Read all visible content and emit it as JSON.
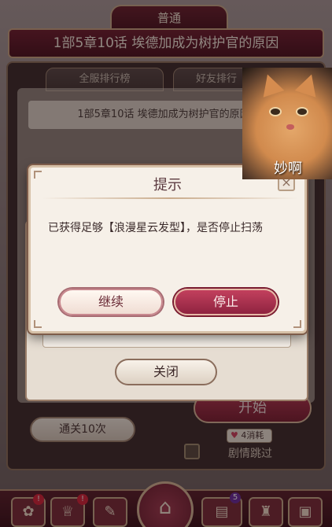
{
  "header": {
    "mode_tab": "普通",
    "chapter_title": "1部5章10话  埃德加成为树护官的原因"
  },
  "rank_tabs": [
    "全服排行榜",
    "好友排行"
  ],
  "stage_subtitle": "1部5章10话  埃德加成为树护官的原因",
  "dialog": {
    "title": "提示",
    "close_label": "×",
    "message": "已获得足够【浪漫星云发型】，是否停止扫荡",
    "continue_label": "继续",
    "stop_label": "停止"
  },
  "background_dialog": {
    "close_label": "关闭"
  },
  "actions": {
    "pass_label": "通关10次",
    "start_label": "开始",
    "cost_label": "4消耗",
    "skip_label": "剧情跳过"
  },
  "bottom_nav": {
    "shop_badge": "5",
    "alert_badge": "!"
  },
  "overlay": {
    "caption": "妙啊"
  },
  "colors": {
    "accent": "#8f2340",
    "frame": "#d6c0a7"
  }
}
